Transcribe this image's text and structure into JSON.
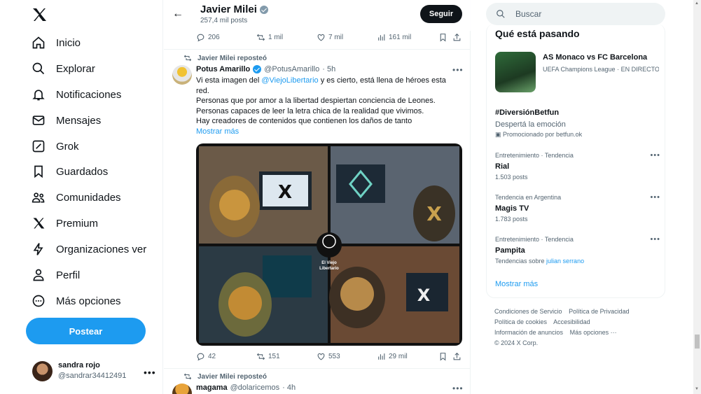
{
  "nav": {
    "items": [
      {
        "label": "Inicio",
        "icon": "home-icon"
      },
      {
        "label": "Explorar",
        "icon": "search-icon"
      },
      {
        "label": "Notificaciones",
        "icon": "bell-icon"
      },
      {
        "label": "Mensajes",
        "icon": "mail-icon"
      },
      {
        "label": "Grok",
        "icon": "grok-icon"
      },
      {
        "label": "Guardados",
        "icon": "bookmark-icon"
      },
      {
        "label": "Comunidades",
        "icon": "people-icon"
      },
      {
        "label": "Premium",
        "icon": "x-logo-icon"
      },
      {
        "label": "Organizaciones ver",
        "icon": "lightning-icon"
      },
      {
        "label": "Perfil",
        "icon": "person-icon"
      },
      {
        "label": "Más opciones",
        "icon": "more-circle-icon"
      }
    ],
    "post_button": "Postear",
    "user": {
      "name": "sandra rojo",
      "handle": "@sandrar34412491"
    }
  },
  "header": {
    "name": "Javier Milei",
    "posts": "257,4 mil posts",
    "follow": "Seguir"
  },
  "top_actions": {
    "replies": "206",
    "reposts": "1 mil",
    "likes": "7 mil",
    "views": "161 mil"
  },
  "tweet1": {
    "reposted_by": "Javier Milei reposteó",
    "name": "Potus Amarillo",
    "handle": "@PotusAmarillo",
    "time": "· 5h",
    "body_pre": "Vi esta imagen del ",
    "mention": "@ViejoLibertario",
    "body_post": " y es cierto, está llena de héroes esta red.",
    "line2": "Personas que por amor a la libertad despiertan conciencia de Leones.",
    "line3": "Personas capaces de leer la letra chica de la realidad que vivimos.",
    "line4": "Hay creadores de contenidos que contienen los daños de tanto",
    "show_more": "Mostrar más",
    "media_caption": "El Viejo Libertario",
    "replies": "42",
    "reposts": "151",
    "likes": "553",
    "views": "29 mil"
  },
  "tweet2": {
    "reposted_by": "Javier Milei reposteó",
    "name": "magama",
    "handle": "@dolaricemos",
    "time": "· 4h"
  },
  "right": {
    "search_placeholder": "Buscar",
    "title": "Qué está pasando",
    "event": {
      "title": "AS Monaco vs FC Barcelona",
      "sub": "UEFA Champions League · EN DIRECTO"
    },
    "promo": {
      "name": "#DiversiónBetfun",
      "desc": "Despertá la emoción",
      "by": "Promocionado por betfun.ok"
    },
    "trends": [
      {
        "meta": "Entretenimiento · Tendencia",
        "name": "Rial",
        "count": "1.503 posts"
      },
      {
        "meta": "Tendencia en Argentina",
        "name": "Magis TV",
        "count": "1.783 posts"
      },
      {
        "meta": "Entretenimiento · Tendencia",
        "name": "Pampita",
        "count_pre": "Tendencias sobre ",
        "count_link": "julian serrano"
      }
    ],
    "show_more": "Mostrar más",
    "footer": [
      "Condiciones de Servicio",
      "Política de Privacidad",
      "Política de cookies",
      "Accesibilidad",
      "Información de anuncios",
      "Más opciones ···",
      "© 2024 X Corp."
    ]
  },
  "colors": {
    "accent": "#1d9bf0",
    "text": "#0f1419",
    "muted": "#536471"
  }
}
